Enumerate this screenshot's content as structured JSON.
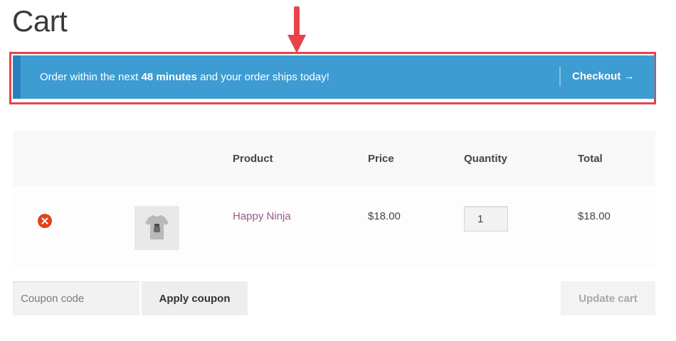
{
  "page": {
    "title": "Cart"
  },
  "notice": {
    "text_before": "Order within the next",
    "text_bold": "48 minutes",
    "text_after": "and your order ships today!",
    "checkout_label": "Checkout →"
  },
  "table": {
    "headers": {
      "product": "Product",
      "price": "Price",
      "quantity": "Quantity",
      "total": "Total"
    },
    "items": [
      {
        "product": "Happy Ninja",
        "price": "$18.00",
        "quantity": "1",
        "total": "$18.00"
      }
    ]
  },
  "actions": {
    "coupon_placeholder": "Coupon code",
    "apply_label": "Apply coupon",
    "update_label": "Update cart"
  },
  "colors": {
    "notice_bg": "#3d9cd2",
    "notice_border": "#2b7fbf",
    "highlight": "#e8434b",
    "product_link": "#96588a",
    "remove": "#e2401c"
  },
  "icons": {
    "arrow": "arrow-down-icon",
    "remove": "remove-x-icon",
    "thumbnail": "tshirt-icon"
  }
}
